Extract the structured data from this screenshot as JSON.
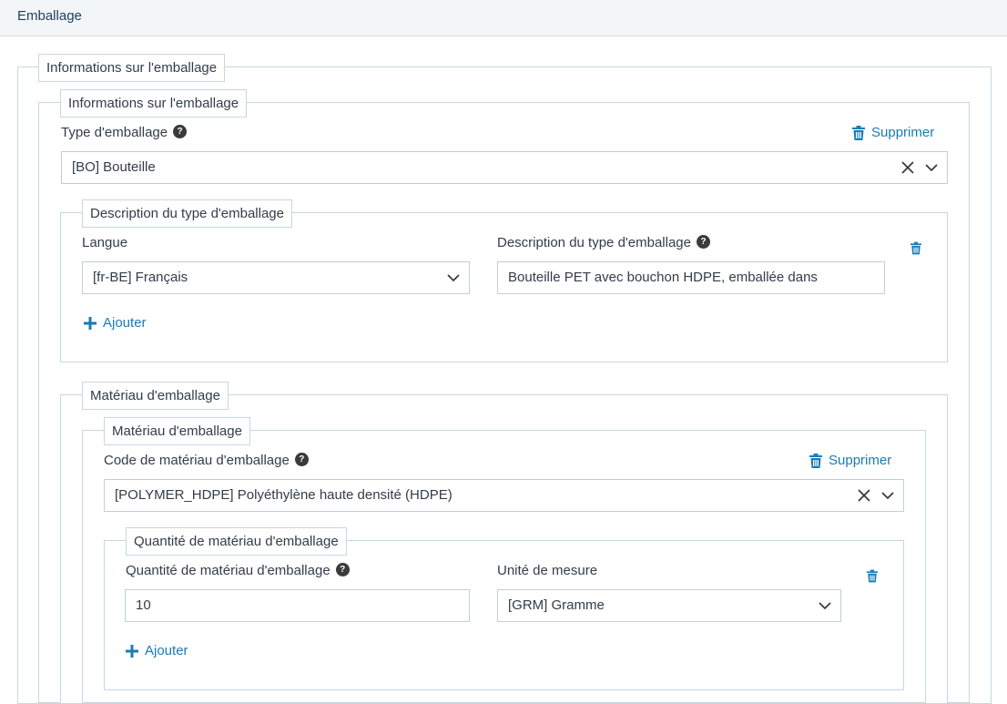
{
  "header": {
    "title": "Emballage"
  },
  "outer": {
    "legend": "Informations sur l'emballage"
  },
  "info": {
    "legend": "Informations sur l'emballage",
    "type_label": "Type d'emballage",
    "type_value": "[BO] Bouteille",
    "delete_label": "Supprimer"
  },
  "description": {
    "legend": "Description du type d'emballage",
    "lang_label": "Langue",
    "lang_value": "[fr-BE] Français",
    "desc_label": "Description du type d'emballage",
    "desc_value": "Bouteille PET avec bouchon HDPE, emballée dans",
    "add_label": "Ajouter"
  },
  "material": {
    "legend": "Matériau d'emballage",
    "inner_legend": "Matériau d'emballage",
    "code_label": "Code de matériau d'emballage",
    "code_value": "[POLYMER_HDPE] Polyéthylène haute densité (HDPE)",
    "delete_label": "Supprimer"
  },
  "quantity": {
    "legend": "Quantité de matériau d'emballage",
    "qty_label": "Quantité de matériau d'emballage",
    "qty_value": "10",
    "unit_label": "Unité de mesure",
    "unit_value": "[GRM] Gramme",
    "add_label": "Ajouter"
  },
  "icons": {
    "help": "question-circle-icon",
    "trash": "trash-icon",
    "clear": "x-icon",
    "dropdown": "chevron-down-icon",
    "add": "plus-icon"
  },
  "colors": {
    "accent": "#1a7bb5",
    "border": "#c8d6e3",
    "header_bg": "#f3f6f9"
  },
  "help_glyph": "?"
}
